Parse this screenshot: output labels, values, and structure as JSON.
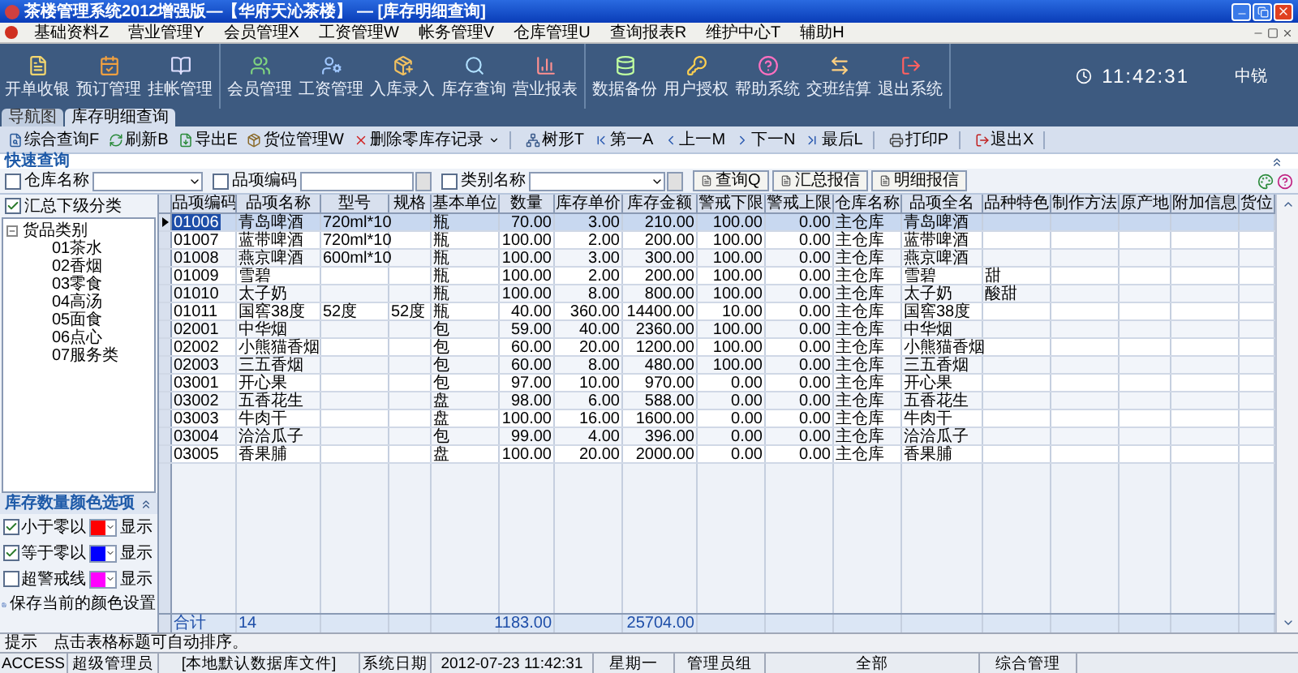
{
  "window": {
    "title": "茶楼管理系统2012增强版—【华府天沁茶楼】 — [库存明细查询]"
  },
  "menu": [
    "基础资料Z",
    "营业管理Y",
    "会员管理X",
    "工资管理W",
    "帐务管理V",
    "仓库管理U",
    "查询报表R",
    "维护中心T",
    "辅助H"
  ],
  "main_toolbar": [
    [
      "开单收银",
      "预订管理",
      "挂帐管理"
    ],
    [
      "会员管理",
      "工资管理",
      "入库录入",
      "库存查询",
      "营业报表"
    ],
    [
      "数据备份",
      "用户授权",
      "帮助系统",
      "交班结算",
      "退出系统"
    ]
  ],
  "clock": "11:42:31",
  "user": "中锐",
  "tabs": [
    {
      "label": "导航图",
      "selected": false
    },
    {
      "label": "库存明细查询",
      "selected": true
    }
  ],
  "toolbar": [
    [
      {
        "label": "综合查询F"
      },
      {
        "label": "刷新B"
      },
      {
        "label": "导出E"
      },
      {
        "label": "货位管理W"
      },
      {
        "label": "删除零库存记录",
        "has_menu": true
      }
    ],
    [
      {
        "label": "树形T"
      },
      {
        "label": "第一A"
      },
      {
        "label": "上一M"
      },
      {
        "label": "下一N"
      },
      {
        "label": "最后L"
      }
    ],
    [
      {
        "label": "打印P"
      }
    ],
    [
      {
        "label": "退出X"
      }
    ]
  ],
  "quick_query": {
    "title": "快速查询",
    "filters": [
      {
        "label": "仓库名称",
        "checked": false,
        "kind": "combo"
      },
      {
        "label": "品项编码",
        "checked": false,
        "kind": "lookup"
      },
      {
        "label": "类别名称",
        "checked": false,
        "kind": "combo_lookup"
      }
    ],
    "buttons": [
      "查询Q",
      "汇总报信",
      "明细报信"
    ]
  },
  "sidebar": {
    "summary": {
      "label": "汇总下级分类",
      "checked": true
    },
    "tree": [
      {
        "label": "货品类别",
        "expanded": true,
        "children": [
          {
            "label": "01茶水"
          },
          {
            "label": "02香烟"
          },
          {
            "label": "03零食"
          },
          {
            "label": "04高汤"
          },
          {
            "label": "05面食"
          },
          {
            "label": "06点心"
          },
          {
            "label": "07服务类"
          }
        ]
      }
    ],
    "color_options": {
      "title": "库存数量颜色选项",
      "items": [
        {
          "label": "小于零以",
          "checked": true,
          "color": "#ff0000",
          "action": "显示"
        },
        {
          "label": "等于零以",
          "checked": true,
          "color": "#0000ff",
          "action": "显示"
        },
        {
          "label": "超警戒线",
          "checked": false,
          "color": "#ff00ff",
          "action": "显示"
        }
      ],
      "save": "保存当前的颜色设置"
    }
  },
  "table": {
    "columns": [
      {
        "label": "品项编码",
        "kind": "text"
      },
      {
        "label": "品项名称",
        "kind": "text"
      },
      {
        "label": "型号",
        "kind": "text"
      },
      {
        "label": "规格",
        "kind": "text"
      },
      {
        "label": "基本单位",
        "kind": "text"
      },
      {
        "label": "数量",
        "kind": "number"
      },
      {
        "label": "库存单价",
        "kind": "number"
      },
      {
        "label": "库存金额",
        "kind": "number"
      },
      {
        "label": "警戒下限",
        "kind": "number"
      },
      {
        "label": "警戒上限",
        "kind": "number"
      },
      {
        "label": "仓库名称",
        "kind": "text"
      },
      {
        "label": "品项全名",
        "kind": "text"
      },
      {
        "label": "品种特色",
        "kind": "text"
      },
      {
        "label": "制作方法",
        "kind": "text"
      },
      {
        "label": "原产地",
        "kind": "text"
      },
      {
        "label": "附加信息",
        "kind": "text"
      },
      {
        "label": "货位",
        "kind": "text"
      }
    ],
    "rows": [
      {
        "selected": true,
        "cells": [
          "01006",
          "青岛啤酒",
          "720ml*10",
          null,
          "瓶",
          "70.00",
          "3.00",
          "210.00",
          "100.00",
          "0.00",
          "主仓库",
          "青岛啤酒"
        ]
      },
      {
        "selected": false,
        "cells": [
          "01007",
          "蓝带啤酒",
          "720ml*10",
          null,
          "瓶",
          "100.00",
          "2.00",
          "200.00",
          "100.00",
          "0.00",
          "主仓库",
          "蓝带啤酒"
        ]
      },
      {
        "selected": false,
        "cells": [
          "01008",
          "燕京啤酒",
          "600ml*10",
          null,
          "瓶",
          "100.00",
          "3.00",
          "300.00",
          "100.00",
          "0.00",
          "主仓库",
          "燕京啤酒"
        ]
      },
      {
        "selected": false,
        "cells": [
          "01009",
          "雪碧",
          null,
          null,
          "瓶",
          "100.00",
          "2.00",
          "200.00",
          "100.00",
          "0.00",
          "主仓库",
          "雪碧",
          "甜"
        ]
      },
      {
        "selected": false,
        "cells": [
          "01010",
          "太子奶",
          null,
          null,
          "瓶",
          "100.00",
          "8.00",
          "800.00",
          "100.00",
          "0.00",
          "主仓库",
          "太子奶",
          "酸甜"
        ]
      },
      {
        "selected": false,
        "cells": [
          "01011",
          "国窖38度",
          "52度",
          "52度",
          "瓶",
          "40.00",
          "360.00",
          "14400.00",
          "10.00",
          "0.00",
          "主仓库",
          "国窖38度"
        ]
      },
      {
        "selected": false,
        "cells": [
          "02001",
          "中华烟",
          null,
          null,
          "包",
          "59.00",
          "40.00",
          "2360.00",
          "100.00",
          "0.00",
          "主仓库",
          "中华烟"
        ]
      },
      {
        "selected": false,
        "cells": [
          "02002",
          "小熊猫香烟",
          null,
          null,
          "包",
          "60.00",
          "20.00",
          "1200.00",
          "100.00",
          "0.00",
          "主仓库",
          "小熊猫香烟"
        ]
      },
      {
        "selected": false,
        "cells": [
          "02003",
          "三五香烟",
          null,
          null,
          "包",
          "60.00",
          "8.00",
          "480.00",
          "100.00",
          "0.00",
          "主仓库",
          "三五香烟"
        ]
      },
      {
        "selected": false,
        "cells": [
          "03001",
          "开心果",
          null,
          null,
          "包",
          "97.00",
          "10.00",
          "970.00",
          "0.00",
          "0.00",
          "主仓库",
          "开心果"
        ]
      },
      {
        "selected": false,
        "cells": [
          "03002",
          "五香花生",
          null,
          null,
          "盘",
          "98.00",
          "6.00",
          "588.00",
          "0.00",
          "0.00",
          "主仓库",
          "五香花生"
        ]
      },
      {
        "selected": false,
        "cells": [
          "03003",
          "牛肉干",
          null,
          null,
          "盘",
          "100.00",
          "16.00",
          "1600.00",
          "0.00",
          "0.00",
          "主仓库",
          "牛肉干"
        ]
      },
      {
        "selected": false,
        "cells": [
          "03004",
          "洽洽瓜子",
          null,
          null,
          "包",
          "99.00",
          "4.00",
          "396.00",
          "0.00",
          "0.00",
          "主仓库",
          "洽洽瓜子"
        ]
      },
      {
        "selected": false,
        "cells": [
          "03005",
          "香果脯",
          null,
          null,
          "盘",
          "100.00",
          "20.00",
          "2000.00",
          "0.00",
          "0.00",
          "主仓库",
          "香果脯"
        ]
      }
    ],
    "totals": {
      "label": "合计",
      "count": "14",
      "quantity": "1183.00",
      "amount": "25704.00"
    }
  },
  "hint": {
    "label": "提示",
    "text": "点击表格标题可自动排序。"
  },
  "status_bar": [
    "ACCESS",
    "超级管理员",
    "[本地默认数据库文件]",
    "系统日期",
    "2012-07-23  11:42:31",
    "星期一",
    "管理员组",
    "全部",
    "综合管理"
  ]
}
